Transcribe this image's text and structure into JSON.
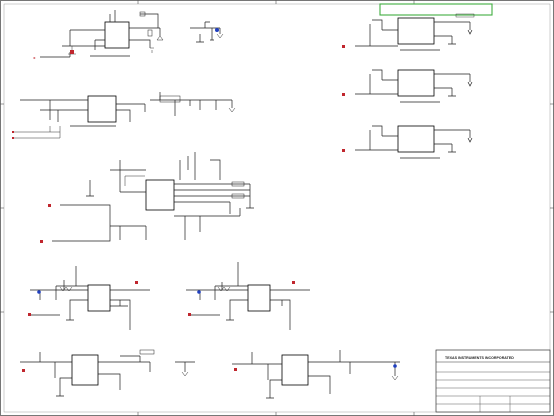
{
  "title_block": {
    "company": "TEXAS INSTRUMENTS INCORPORATED"
  },
  "colors": {
    "wire": "#202020",
    "net_blue": "#1f3fbf",
    "net_red": "#c0262d",
    "note_box": "#3fae3f",
    "border": "#555555"
  }
}
